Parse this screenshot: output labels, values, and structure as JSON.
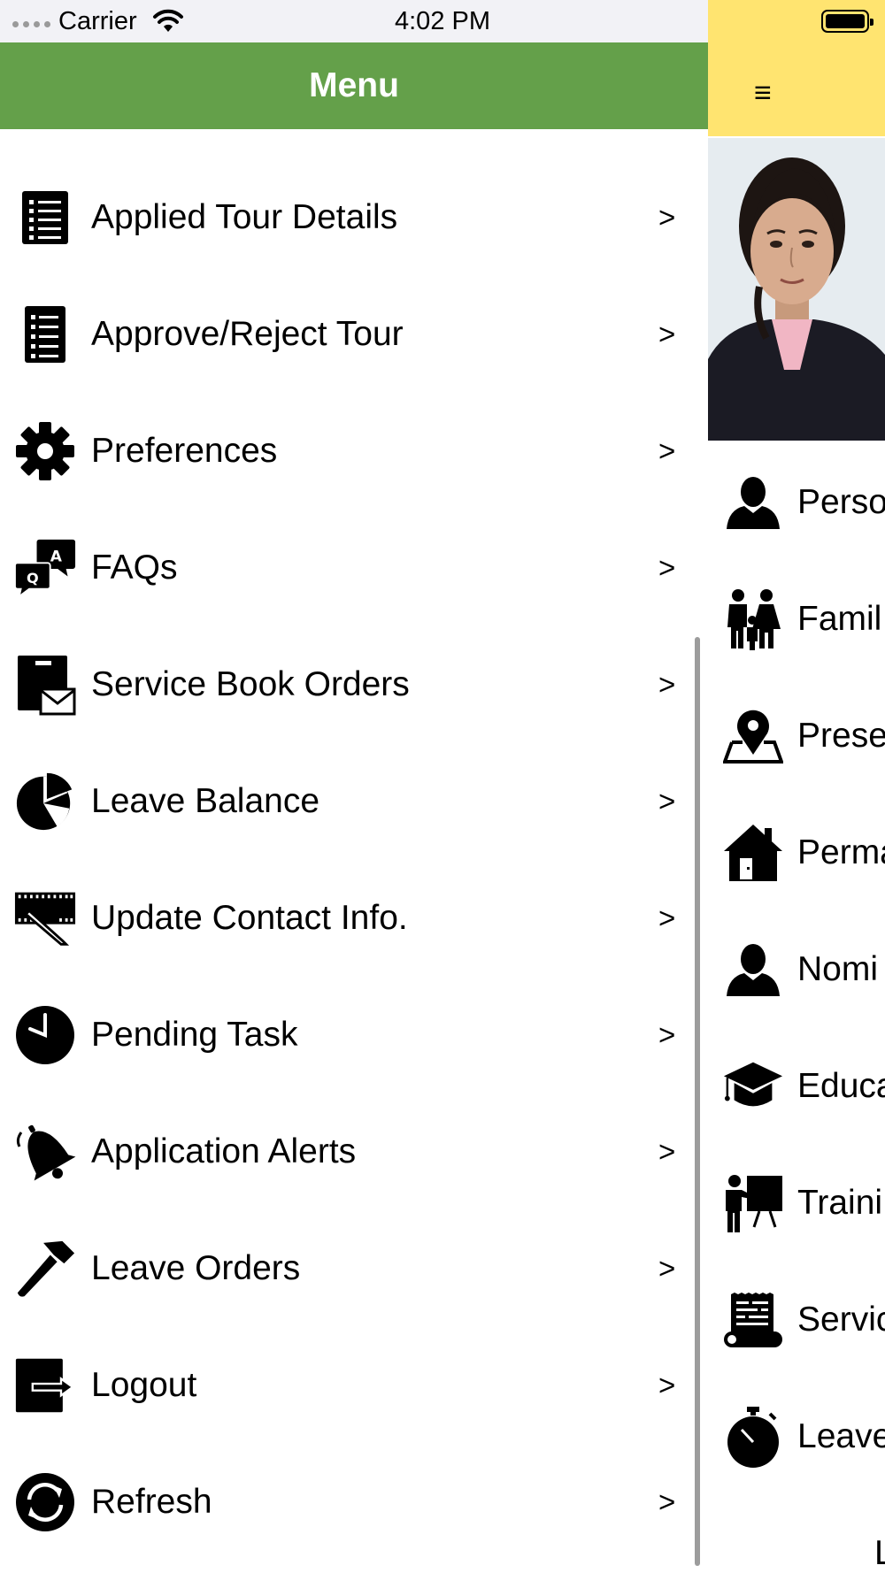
{
  "status_bar": {
    "carrier": "Carrier",
    "time": "4:02 PM"
  },
  "drawer": {
    "title": "Menu",
    "header_color": "#64a04a",
    "chevron": ">",
    "items": [
      {
        "label": "Applied Tour Details",
        "icon": "list-icon"
      },
      {
        "label": "Approve/Reject Tour",
        "icon": "list-icon"
      },
      {
        "label": "Preferences",
        "icon": "gear-icon"
      },
      {
        "label": "FAQs",
        "icon": "faq-icon"
      },
      {
        "label": "Service Book Orders",
        "icon": "mail-box-icon"
      },
      {
        "label": "Leave Balance",
        "icon": "pie-chart-icon"
      },
      {
        "label": "Update Contact Info.",
        "icon": "ruler-pen-icon"
      },
      {
        "label": "Pending Task",
        "icon": "clock-icon"
      },
      {
        "label": "Application Alerts",
        "icon": "bell-icon"
      },
      {
        "label": "Leave Orders",
        "icon": "hammer-icon"
      },
      {
        "label": "Logout",
        "icon": "logout-icon"
      },
      {
        "label": "Refresh",
        "icon": "refresh-icon"
      }
    ]
  },
  "main_screen": {
    "header_color": "#ffe470",
    "menu_glyph": "≡",
    "items": [
      {
        "label": "Perso",
        "icon": "person-icon"
      },
      {
        "label": "Famil",
        "icon": "family-icon"
      },
      {
        "label": "Prese",
        "icon": "map-pin-icon"
      },
      {
        "label": "Perma",
        "icon": "house-icon"
      },
      {
        "label": "Nomi",
        "icon": "person-icon"
      },
      {
        "label": "Educa",
        "icon": "graduation-cap-icon"
      },
      {
        "label": "Traini",
        "icon": "teacher-board-icon"
      },
      {
        "label": "Servic",
        "icon": "scroll-icon"
      },
      {
        "label": "Leave",
        "icon": "stopwatch-icon"
      }
    ],
    "footer_text": "L"
  }
}
